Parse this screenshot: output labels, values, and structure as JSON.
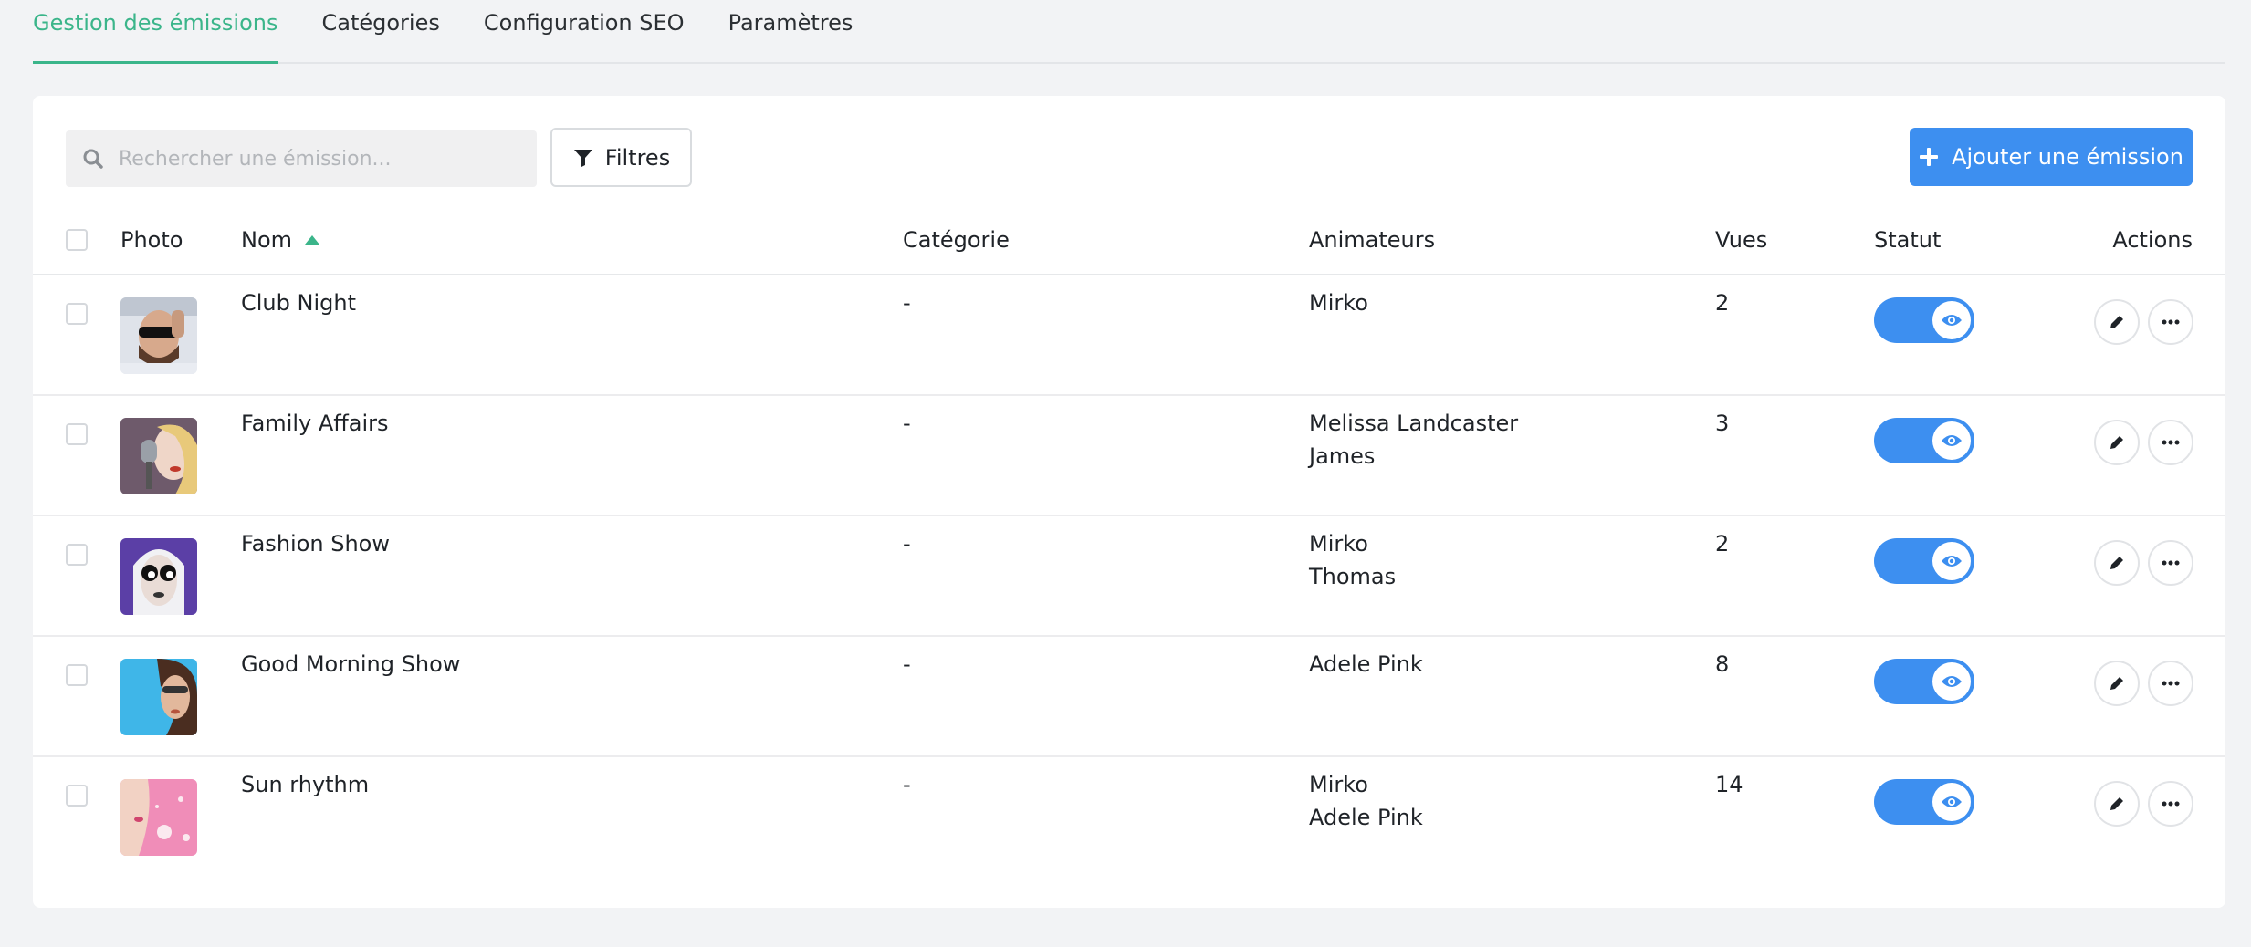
{
  "tabs": [
    {
      "label": "Gestion des émissions",
      "active": true
    },
    {
      "label": "Catégories",
      "active": false
    },
    {
      "label": "Configuration SEO",
      "active": false
    },
    {
      "label": "Paramètres",
      "active": false
    }
  ],
  "toolbar": {
    "search_placeholder": "Rechercher une émission...",
    "filter_label": "Filtres",
    "add_label": "Ajouter une émission"
  },
  "table": {
    "headers": {
      "photo": "Photo",
      "nom": "Nom",
      "categorie": "Catégorie",
      "animateurs": "Animateurs",
      "vues": "Vues",
      "statut": "Statut",
      "actions": "Actions"
    },
    "sort": {
      "column": "Nom",
      "direction": "asc"
    },
    "rows": [
      {
        "name": "Club Night",
        "category": "-",
        "host1": "Mirko",
        "host2": "",
        "views": "2",
        "status_visible": true
      },
      {
        "name": "Family Affairs",
        "category": "-",
        "host1": "Melissa Landcaster",
        "host2": "James",
        "views": "3",
        "status_visible": true
      },
      {
        "name": "Fashion Show",
        "category": "-",
        "host1": "Mirko",
        "host2": "Thomas",
        "views": "2",
        "status_visible": true
      },
      {
        "name": "Good Morning Show",
        "category": "-",
        "host1": "Adele Pink",
        "host2": "",
        "views": "8",
        "status_visible": true
      },
      {
        "name": "Sun rhythm",
        "category": "-",
        "host1": "Mirko",
        "host2": "Adele Pink",
        "views": "14",
        "status_visible": true
      }
    ]
  },
  "colors": {
    "accent_green": "#3bb58a",
    "primary_blue": "#3d8ff0",
    "background": "#f2f3f5"
  },
  "icons": [
    "search-icon",
    "filter-icon",
    "plus-icon",
    "eye-icon",
    "pencil-icon",
    "ellipsis-icon"
  ]
}
